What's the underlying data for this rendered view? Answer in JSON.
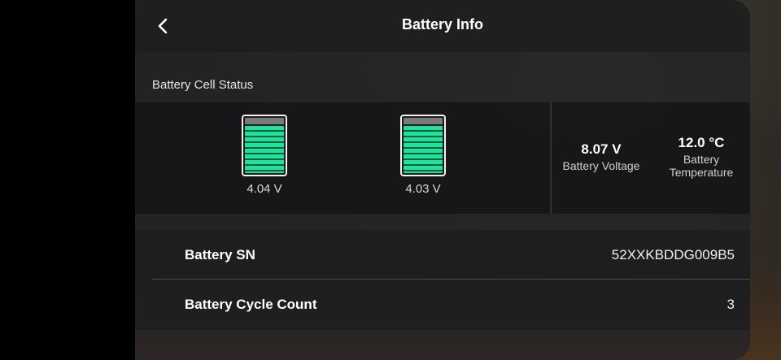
{
  "header": {
    "title": "Battery Info",
    "back_icon": "chevron-left-icon"
  },
  "cell_status": {
    "label": "Battery Cell Status",
    "fill_color": "#1ee39a",
    "cells": [
      {
        "voltage": "4.04 V",
        "level": 1.0
      },
      {
        "voltage": "4.03 V",
        "level": 1.0
      }
    ]
  },
  "stats": {
    "voltage": {
      "value": "8.07 V",
      "label": "Battery Voltage"
    },
    "temperature": {
      "value": "12.0 °C",
      "label_line1": "Battery",
      "label_line2": "Temperature"
    }
  },
  "info": {
    "sn": {
      "label": "Battery SN",
      "value": "52XXKBDDG009B5"
    },
    "cycle_count": {
      "label": "Battery Cycle Count",
      "value": "3"
    }
  }
}
